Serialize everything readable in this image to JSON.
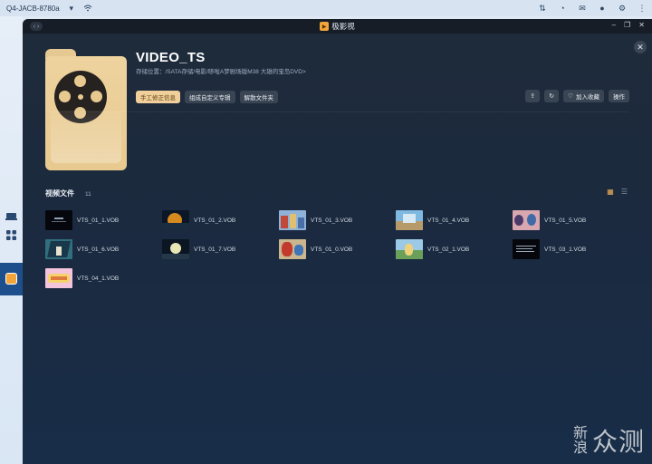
{
  "os_bar": {
    "device_name": "Q4-JACB-8780a"
  },
  "window": {
    "title": "极影视"
  },
  "folder": {
    "title": "VIDEO_TS",
    "path": "存储位置：/SATA存储/电影/哆啦A梦剧场版M38 大雄的宝岛DVD>"
  },
  "actions": {
    "manual_fix": "手工修正信息",
    "form_album": "组成自定义专辑",
    "dissolve_folder": "解散文件夹",
    "add_favorite": "加入收藏",
    "operate": "操作"
  },
  "section": {
    "title": "视频文件",
    "count": "11"
  },
  "files": [
    {
      "name": "VTS_01_1.VOB",
      "thumb": "dark"
    },
    {
      "name": "VTS_01_2.VOB",
      "thumb": "moon"
    },
    {
      "name": "VTS_01_3.VOB",
      "thumb": "city"
    },
    {
      "name": "VTS_01_4.VOB",
      "thumb": "scene-blue"
    },
    {
      "name": "VTS_01_5.VOB",
      "thumb": "characters"
    },
    {
      "name": "VTS_01_6.VOB",
      "thumb": "teal"
    },
    {
      "name": "VTS_01_7.VOB",
      "thumb": "night"
    },
    {
      "name": "VTS_01_0.VOB",
      "thumb": "indoor"
    },
    {
      "name": "VTS_02_1.VOB",
      "thumb": "outdoor"
    },
    {
      "name": "VTS_03_1.VOB",
      "thumb": "text"
    },
    {
      "name": "VTS_04_1.VOB",
      "thumb": "logo"
    }
  ],
  "watermark": {
    "line1": "新",
    "line2": "浪",
    "brand": "众测"
  },
  "colors": {
    "accent": "#f1cf9a",
    "window_bg": "#1b2a3f",
    "folder": "#e8c98f"
  }
}
